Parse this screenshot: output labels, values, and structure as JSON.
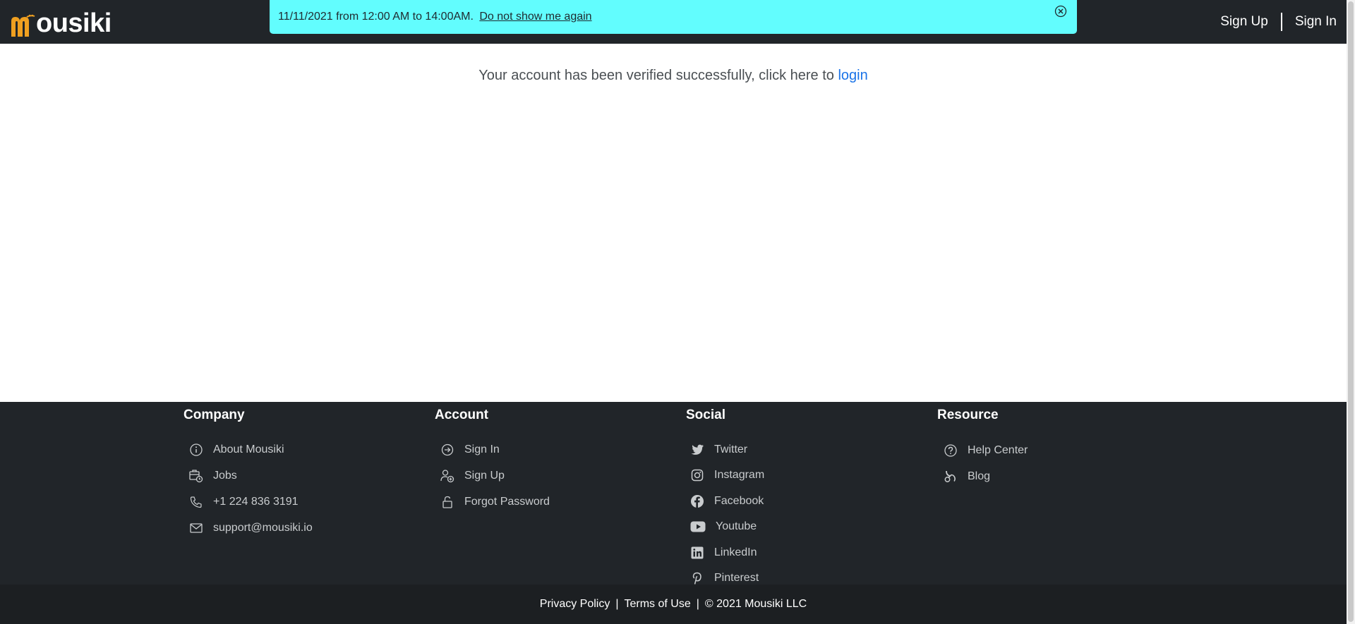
{
  "header": {
    "logo_text": "ousiki",
    "sign_up": "Sign Up",
    "sign_in": "Sign In"
  },
  "banner": {
    "text": "11/11/2021 from 12:00 AM to 14:00AM.",
    "dismiss_link": "Do not show me again",
    "background_color": "#62fdfe"
  },
  "main": {
    "message": "Your account has been verified successfully, click here to",
    "login_link": "login",
    "link_color": "#1a73e8"
  },
  "footer": {
    "company": {
      "heading": "Company",
      "items": [
        {
          "label": "About Mousiki",
          "icon": "info-icon"
        },
        {
          "label": "Jobs",
          "icon": "jobs-icon"
        },
        {
          "label": "+1 224 836 3191",
          "icon": "phone-icon"
        },
        {
          "label": "support@mousiki.io",
          "icon": "mail-icon"
        }
      ]
    },
    "account": {
      "heading": "Account",
      "items": [
        {
          "label": "Sign In",
          "icon": "sign-in-icon"
        },
        {
          "label": "Sign Up",
          "icon": "user-add-icon"
        },
        {
          "label": "Forgot Password",
          "icon": "lock-icon"
        }
      ]
    },
    "social": {
      "heading": "Social",
      "items": [
        {
          "label": "Twitter",
          "icon": "twitter-icon"
        },
        {
          "label": "Instagram",
          "icon": "instagram-icon"
        },
        {
          "label": "Facebook",
          "icon": "facebook-icon"
        },
        {
          "label": "Youtube",
          "icon": "youtube-icon"
        },
        {
          "label": "LinkedIn",
          "icon": "linkedin-icon"
        },
        {
          "label": "Pinterest",
          "icon": "pinterest-icon"
        }
      ]
    },
    "resource": {
      "heading": "Resource",
      "items": [
        {
          "label": "Help Center",
          "icon": "help-icon"
        },
        {
          "label": "Blog",
          "icon": "blog-icon"
        }
      ]
    },
    "bottom": {
      "privacy": "Privacy Policy",
      "terms": "Terms of Use",
      "copyright": "© 2021 Mousiki LLC",
      "separator": "|"
    }
  },
  "colors": {
    "navbar": "#212529",
    "footer": "#212529",
    "bottom_bar": "#1c1f22",
    "logo_accent": "#f0a020"
  }
}
